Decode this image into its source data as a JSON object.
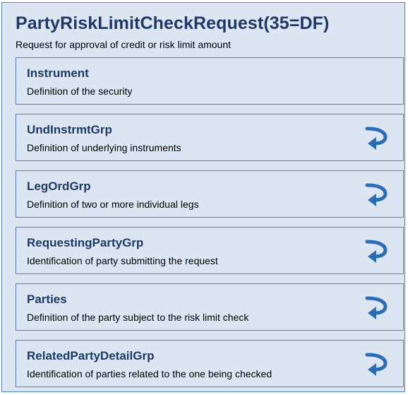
{
  "message": {
    "title": "PartyRiskLimitCheckRequest(35=DF)",
    "description": "Request for approval of credit or risk limit amount"
  },
  "components": [
    {
      "name": "Instrument",
      "description": "Definition of the security",
      "icon": null
    },
    {
      "name": "UndInstrmtGrp",
      "description": "Definition of underlying instruments",
      "icon": "repeating-group-icon"
    },
    {
      "name": "LegOrdGrp",
      "description": "Definition of two or more individual legs",
      "icon": "repeating-group-icon"
    },
    {
      "name": "RequestingPartyGrp",
      "description": "Identification of party submitting the request",
      "icon": "repeating-group-icon"
    },
    {
      "name": "Parties",
      "description": "Definition of the party subject to the risk limit check",
      "icon": "repeating-group-icon"
    },
    {
      "name": "RelatedPartyDetailGrp",
      "description": "Identification of parties related to the one being checked",
      "icon": "repeating-group-icon"
    }
  ],
  "colors": {
    "panel_background": "#dce6f2",
    "border": "#4f81bd",
    "heading_text": "#1f3864",
    "icon": "#2e6db4"
  }
}
